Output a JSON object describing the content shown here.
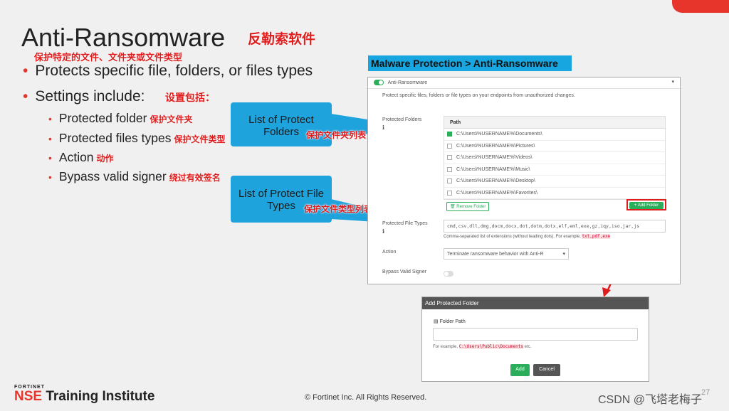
{
  "slide": {
    "title": "Anti-Ransomware",
    "title_cn": "反勒索软件",
    "sub_cn": "保护特定的文件、文件夹或文件类型",
    "bullet1": "Protects specific file, folders, or files types",
    "bullet2": "Settings include:",
    "bullet2_cn": "设置包括：",
    "subbullets": [
      {
        "text": "Protected folder",
        "cn": "保护文件夹"
      },
      {
        "text": "Protected files types",
        "cn": "保护文件类型"
      },
      {
        "text": "Action",
        "cn": "动作"
      },
      {
        "text": "Bypass valid signer",
        "cn": "绕过有效签名"
      }
    ],
    "callout1": {
      "line1": "List of Protect",
      "line2": "Folders",
      "cn": "保护文件夹列表"
    },
    "callout2": {
      "line1": "List of Protect File",
      "line2": "Types",
      "cn": "保护文件类型列表"
    },
    "accent_color": "#e8352c",
    "callout_color": "#1ea3dd"
  },
  "panel": {
    "breadcrumb": "Malware Protection > Anti-Ransomware",
    "header": "Anti-Ransomware",
    "description": "Protect specific files, folders or file types on your endpoints from unauthorized changes.",
    "folders_label": "Protected Folders",
    "path_header": "Path",
    "folders": [
      {
        "path": "C:\\Users\\%USERNAME%\\Documents\\",
        "checked": true
      },
      {
        "path": "C:\\Users\\%USERNAME%\\Pictures\\",
        "checked": false
      },
      {
        "path": "C:\\Users\\%USERNAME%\\Videos\\",
        "checked": false
      },
      {
        "path": "C:\\Users\\%USERNAME%\\Music\\",
        "checked": false
      },
      {
        "path": "C:\\Users\\%USERNAME%\\Desktop\\",
        "checked": false
      },
      {
        "path": "C:\\Users\\%USERNAME%\\Favorites\\",
        "checked": false
      }
    ],
    "remove_folder": "Remove Folder",
    "add_folder": "+ Add Folder",
    "filetypes_label": "Protected File Types",
    "filetypes_value": "cmd,csv,dll,dmg,docm,docx,dot,dotm,dotx,elf,eml,exe,gz,iqy,iso,jar,js",
    "filetypes_hint": "Comma-separated list of extensions (without leading dots). For example,",
    "filetypes_example": "txt,pdf,exe",
    "action_label": "Action",
    "action_value": "Terminate ransomware behavior with Anti-R",
    "bypass_label": "Bypass Valid Signer"
  },
  "modal": {
    "title": "Add Protected Folder",
    "field_label": "Folder Path",
    "hint_prefix": "For example,",
    "hint_example": "C:\\Users\\Public\\Documents",
    "hint_suffix": "etc.",
    "add": "Add",
    "cancel": "Cancel"
  },
  "footer": {
    "brand_small": "FORTINET",
    "brand": "NSE",
    "brand_rest": "Training Institute",
    "copyright": "© Fortinet Inc. All Rights Reserved.",
    "page_number": "27",
    "watermark": "CSDN @飞塔老梅子"
  }
}
